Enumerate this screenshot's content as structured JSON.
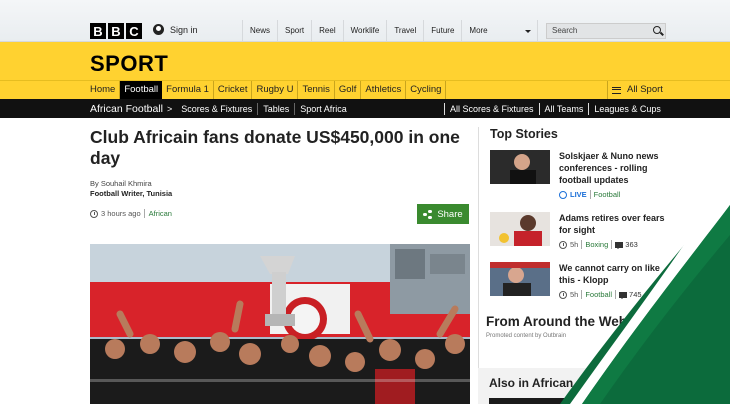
{
  "bbc_bar": {
    "logo": [
      "B",
      "B",
      "C"
    ],
    "sign_in": "Sign in",
    "nav": [
      "News",
      "Sport",
      "Reel",
      "Worklife",
      "Travel",
      "Future"
    ],
    "more": "More",
    "search_placeholder": "Search"
  },
  "sport_header": {
    "title": "SPORT",
    "nav": [
      "Home",
      "Football",
      "Formula 1",
      "Cricket",
      "Rugby U",
      "Tennis",
      "Golf",
      "Athletics",
      "Cycling"
    ],
    "active_item": "Football",
    "all_sport": "All Sport"
  },
  "subnav": {
    "section": "African Football",
    "links": [
      "Scores & Fixtures",
      "Tables",
      "Sport Africa"
    ],
    "right_links": [
      "All Scores & Fixtures",
      "All Teams",
      "Leagues & Cups"
    ]
  },
  "article": {
    "headline": "Club Africain fans donate US$450,000 in one day",
    "byline": "By Souhail Khmira",
    "role": "Football Writer, Tunisia",
    "time": "3 hours ago",
    "tag": "African",
    "share": "Share"
  },
  "top_stories": {
    "title": "Top Stories",
    "items": [
      {
        "title": "Solskjaer & Nuno news conferences - rolling football updates",
        "live": "LIVE",
        "tag": "Football",
        "time": "",
        "comments": ""
      },
      {
        "title": "Adams retires over fears for sight",
        "live": "",
        "time": "5h",
        "tag": "Boxing",
        "comments": "363"
      },
      {
        "title": "We cannot carry on like this - Klopp",
        "live": "",
        "time": "5h",
        "tag": "Football",
        "comments": "745"
      }
    ]
  },
  "outbrain": {
    "title": "From Around the Web",
    "promoted": "Promoted content by Outbrain"
  },
  "also_in": {
    "title": "Also in African sport"
  },
  "colors": {
    "sport_yellow": "#ffd230",
    "share_green": "#3a8a2f",
    "live_blue": "#1b6fd8",
    "tag_green": "#2a7a3a"
  }
}
